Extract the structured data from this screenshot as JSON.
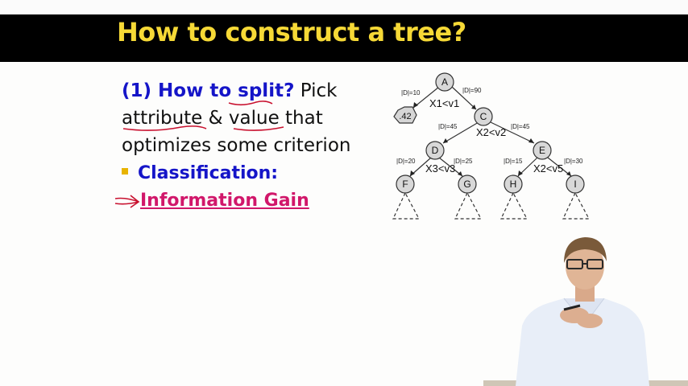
{
  "slide": {
    "title": "How to construct a tree?",
    "line1_prefix": "(1) How to ",
    "line1_split": "split",
    "line1_q": "?",
    "line1_pick": " Pick",
    "line2_attr": "attribute",
    "line2_amp": " & ",
    "line2_value": "value",
    "line2_rest": " that",
    "line3": "optimizes some criterion",
    "bullet": "Classification:",
    "info_gain": "Information Gain"
  },
  "tree": {
    "nodes": [
      "A",
      "C",
      "D",
      "E",
      "F",
      "G",
      "H",
      "I"
    ],
    "leaf_value": ".42",
    "edge_labels": [
      "|D|=10",
      "|D|=90",
      "|D|=45",
      "|D|=45",
      "|D|=20",
      "|D|=25",
      "|D|=15",
      "|D|=30"
    ],
    "split_labels": [
      "X1<v1",
      "X2<v2",
      "X3<v3",
      "X2<v5"
    ]
  },
  "colors": {
    "title": "#f6d936",
    "title_bg": "#000000",
    "blue": "#1515c8",
    "pink": "#d1176a",
    "bullet": "#e8b400",
    "annotation": "#c8102e"
  }
}
